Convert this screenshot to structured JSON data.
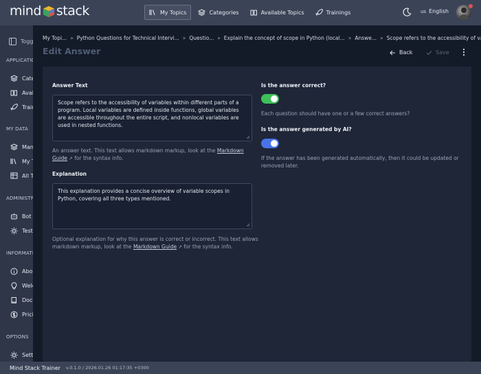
{
  "brand": {
    "name_left": "mind",
    "name_right": "stack"
  },
  "nav": {
    "items": [
      {
        "label": "My Topics",
        "icon": "library-icon",
        "active": true
      },
      {
        "label": "Categories",
        "icon": "layers-icon",
        "active": false
      },
      {
        "label": "Available Topics",
        "icon": "book-open-icon",
        "active": false
      },
      {
        "label": "Trainings",
        "icon": "rocket-icon",
        "active": false
      }
    ],
    "language_code": "us",
    "language": "English"
  },
  "sidebar": {
    "toggle_label": "Toggle",
    "sections": [
      {
        "heading": "APPLICATION",
        "items": [
          {
            "label": "Categories",
            "icon": "layers-icon"
          },
          {
            "label": "Available Topics",
            "icon": "book-open-icon"
          },
          {
            "label": "Trainings",
            "icon": "rocket-icon"
          }
        ]
      },
      {
        "heading": "MY DATA",
        "items": [
          {
            "label": "Manage",
            "icon": "layers-icon"
          },
          {
            "label": "My Topics",
            "icon": "library-icon"
          },
          {
            "label": "All Topics",
            "icon": "table-icon"
          }
        ]
      },
      {
        "heading": "ADMINISTRATION",
        "items": [
          {
            "label": "Bot",
            "icon": "bot-icon"
          },
          {
            "label": "Test",
            "icon": "gear-icon"
          }
        ]
      },
      {
        "heading": "INFORMATION",
        "items": [
          {
            "label": "About",
            "icon": "info-icon"
          },
          {
            "label": "Welcome",
            "icon": "lightbulb-icon"
          },
          {
            "label": "Docs",
            "icon": "book-icon"
          },
          {
            "label": "Pricing",
            "icon": "dollar-icon"
          }
        ]
      },
      {
        "heading": "OPTIONS",
        "items": [
          {
            "label": "Settings",
            "icon": "gear-icon"
          }
        ]
      }
    ]
  },
  "breadcrumb": [
    "My Topi...",
    "Python Questions for Technical Intervi...",
    "Questio...",
    "Explain the concept of scope in Python (local...",
    "Answe...",
    "Scope refers to the accessibility of variable..."
  ],
  "page": {
    "title": "Edit Answer",
    "back_label": "Back",
    "save_label": "Save"
  },
  "form": {
    "answer_text": {
      "label": "Answer Text",
      "value": "Scope refers to the accessibility of variables within different parts of a program. Local variables are defined inside functions, global variables are accessible throughout the entire script, and nonlocal variables are used in nested functions.",
      "help_before": "An answer text. This text allows markdown markup, look at the ",
      "help_link": "Markdown Guide",
      "help_after": " for the syntax info."
    },
    "explanation": {
      "label": "Explanation",
      "value": "This explanation provides a concise overview of variable scopes in Python, covering all three types mentioned.",
      "help_before": "Optional explanation for why this answer is correct or incorrect. This text allows markdown markup, look at the ",
      "help_link": "Markdown Guide",
      "help_after": " for the syntax info."
    },
    "is_correct": {
      "label": "Is the answer correct?",
      "checked": true,
      "color": "#3fbf5a",
      "help": "Each question should have one or a few correct answers?"
    },
    "is_ai": {
      "label": "Is the answer generated by AI?",
      "checked": true,
      "color": "#4a72e8",
      "help": "If the answer has been generated automatically, then it could be updated or removed later."
    }
  },
  "footer": {
    "app_name": "Mind Stack Trainer",
    "version": "v.0.1.0 / 2026.01.26 01:17:35 +0300"
  }
}
